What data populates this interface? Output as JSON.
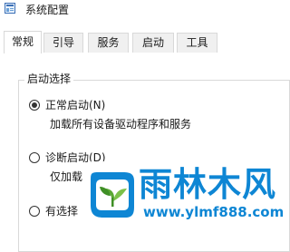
{
  "window": {
    "title": "系统配置"
  },
  "tabs": [
    {
      "label": "常规",
      "active": true
    },
    {
      "label": "引导",
      "active": false
    },
    {
      "label": "服务",
      "active": false
    },
    {
      "label": "启动",
      "active": false
    },
    {
      "label": "工具",
      "active": false
    }
  ],
  "startup_group": {
    "legend": "启动选择",
    "options": [
      {
        "label": "正常启动(N)",
        "checked": true,
        "description": "加载所有设备驱动程序和服务"
      },
      {
        "label": "诊断启动(D)",
        "checked": false,
        "description": "仅加载"
      },
      {
        "label": "有选择",
        "checked": false,
        "description": ""
      }
    ]
  },
  "watermark": {
    "brand": "雨林木风",
    "url": "www.ylmf888.com"
  },
  "colors": {
    "watermark_blue": "#0e86d4",
    "tab_border": "#d9d9d9",
    "window_bg": "#ffffff"
  }
}
